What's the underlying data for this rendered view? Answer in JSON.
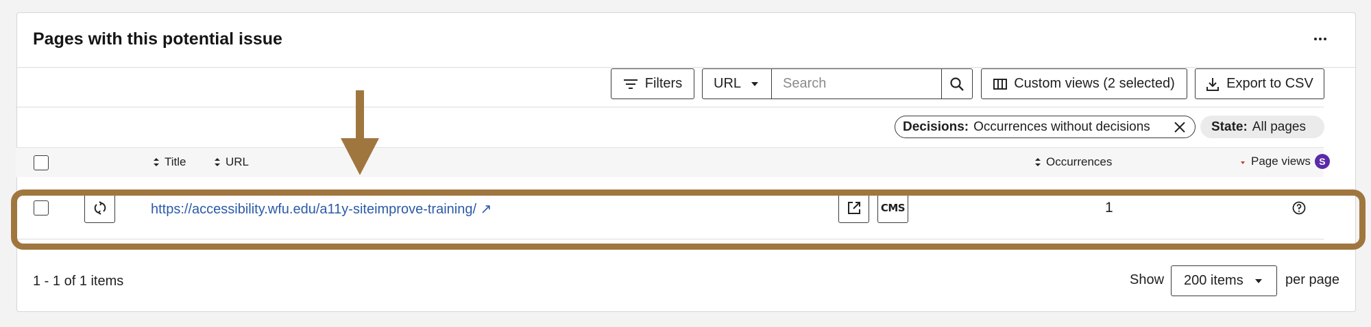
{
  "card": {
    "title": "Pages with this potential issue",
    "more_icon": "more-horizontal-icon"
  },
  "toolbar": {
    "filters_label": "Filters",
    "field_select_value": "URL",
    "search_placeholder": "Search",
    "custom_views_label": "Custom views (2 selected)",
    "export_label": "Export to CSV"
  },
  "chips": {
    "decisions_key": "Decisions:",
    "decisions_value": "Occurrences without decisions",
    "state_key": "State:",
    "state_value": "All pages"
  },
  "table": {
    "headers": {
      "title": "Title",
      "url": "URL",
      "occurrences": "Occurrences",
      "page_views": "Page views",
      "page_views_badge": "S"
    },
    "rows": [
      {
        "url": "https://accessibility.wfu.edu/a11y-siteimprove-training/",
        "url_suffix_icon": "↗",
        "cms_label": "CMS",
        "occurrences": "1"
      }
    ]
  },
  "pagination": {
    "summary": "1 - 1 of 1 items",
    "show_label": "Show",
    "page_size": "200 items",
    "per_page_label": "per page"
  },
  "colors": {
    "highlight": "#a0763f",
    "link": "#2a5aa8",
    "badge": "#5a2aa8"
  }
}
